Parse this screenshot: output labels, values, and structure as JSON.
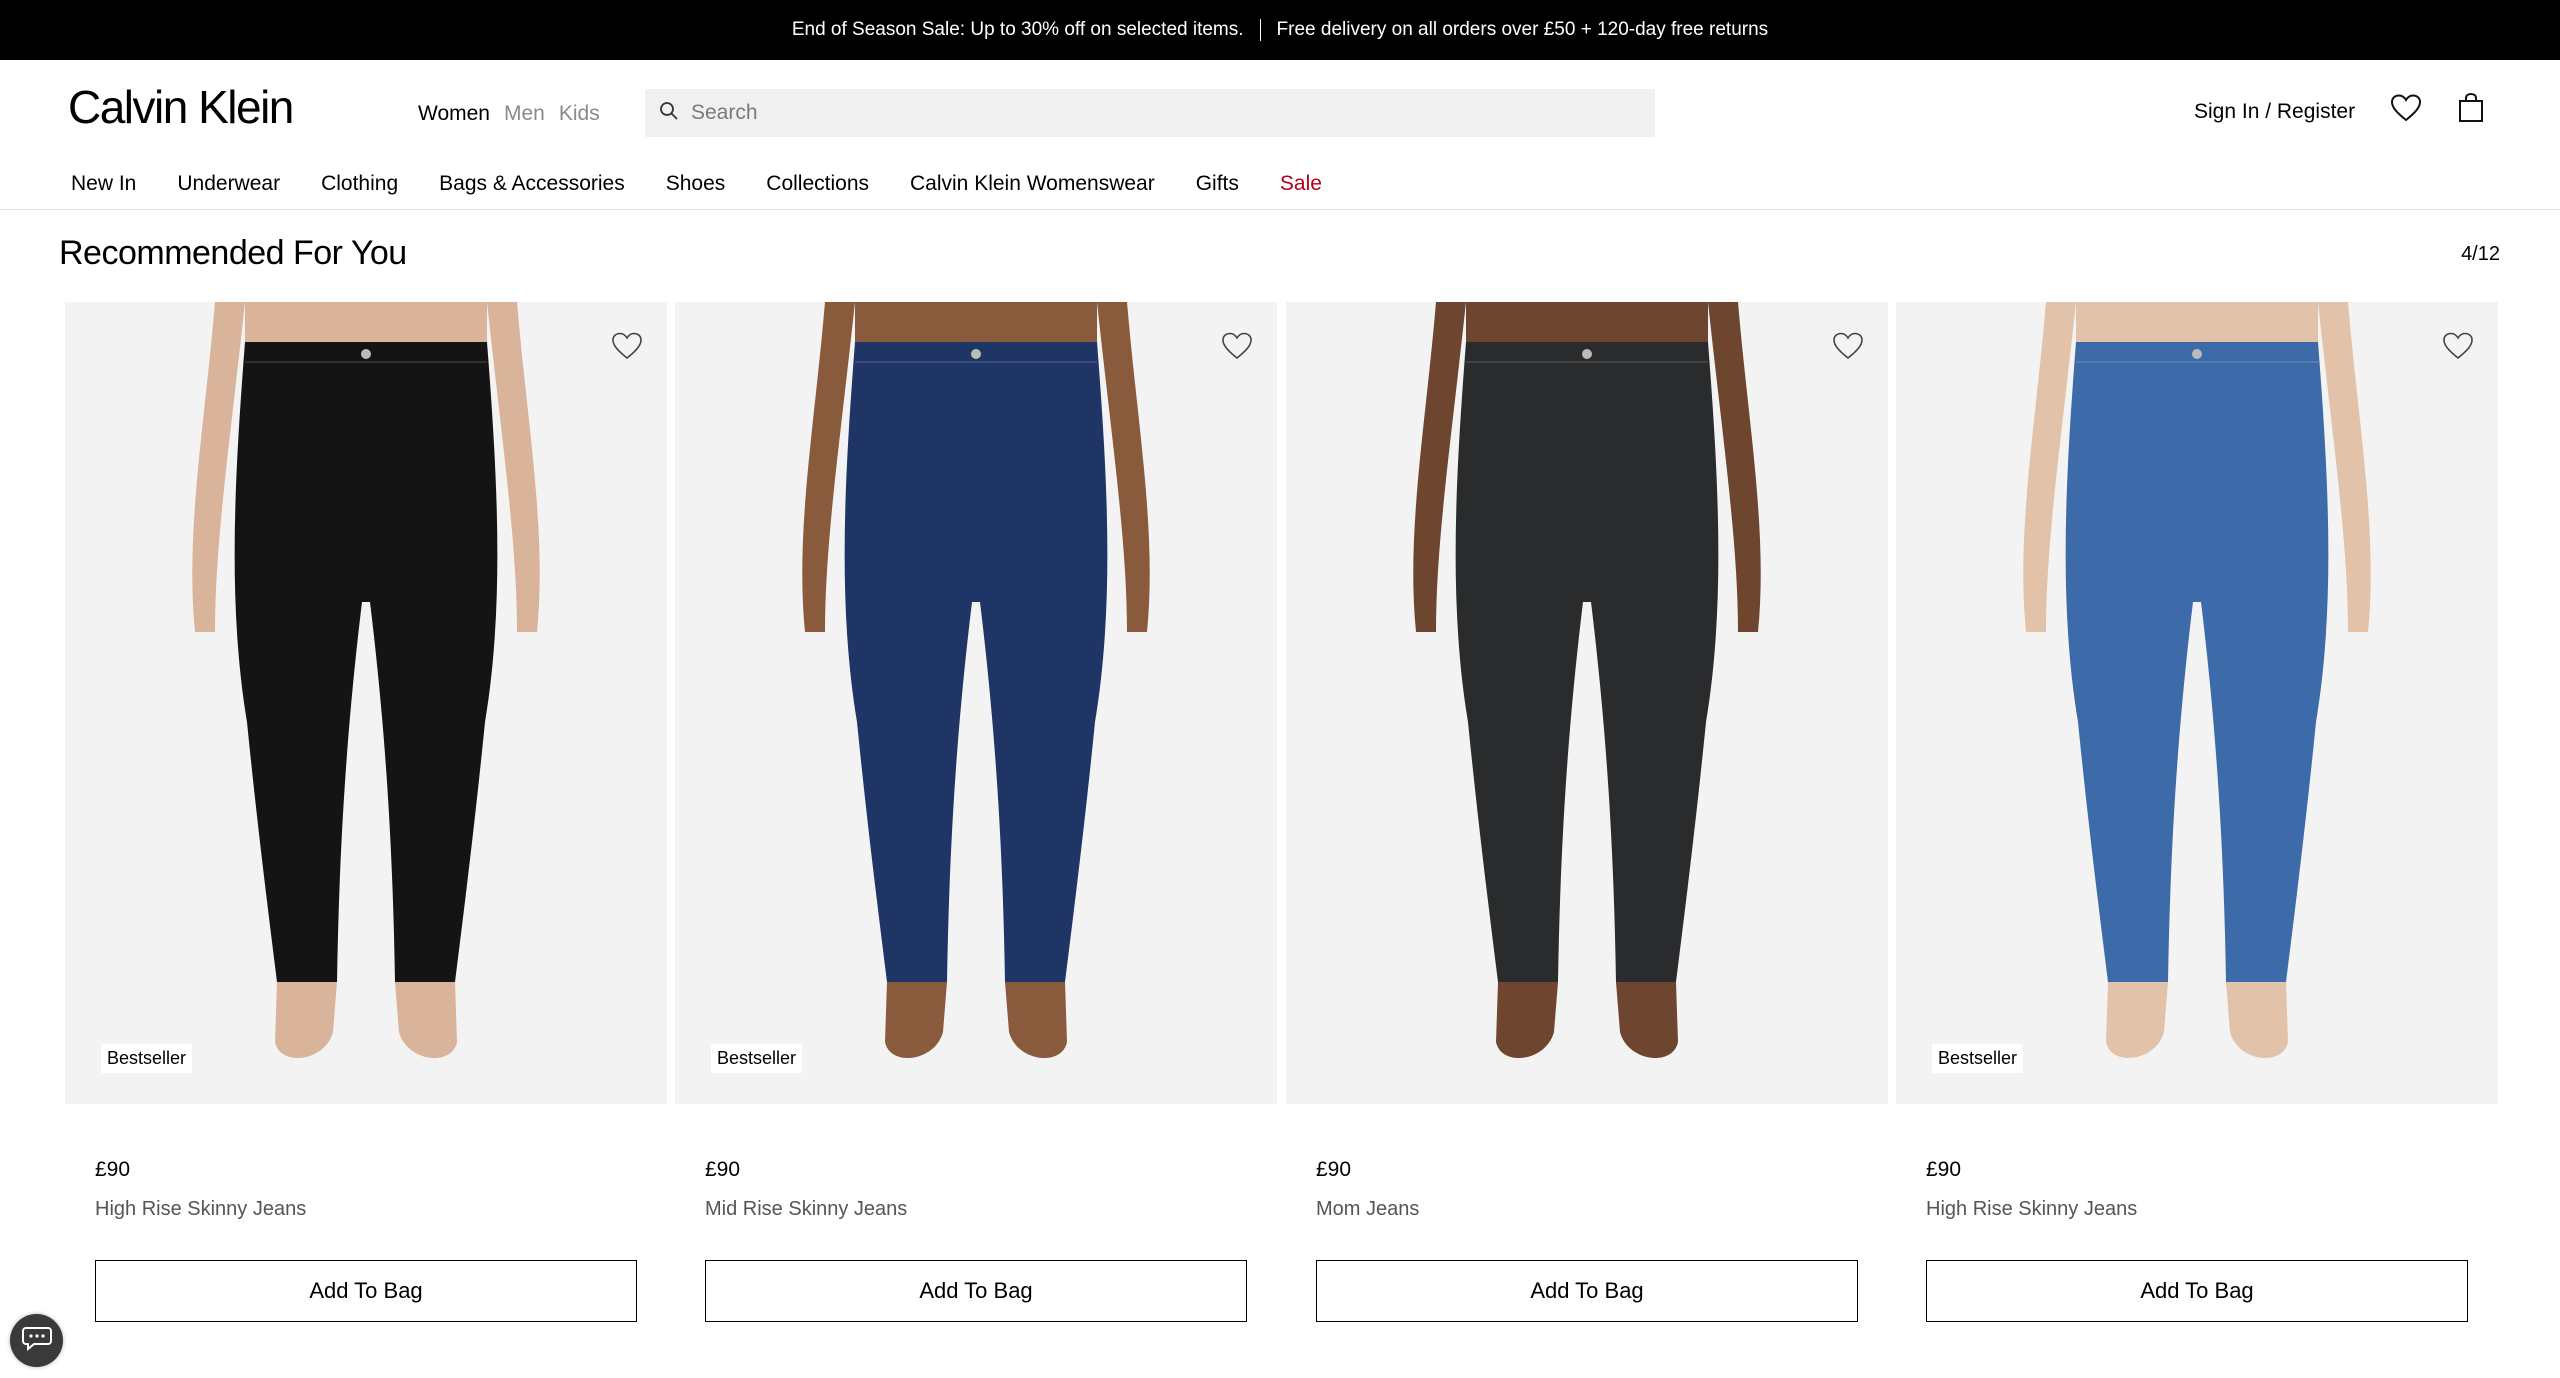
{
  "announcement": {
    "left": "End of Season Sale: Up to 30% off on selected items.",
    "right": "Free delivery on all orders over £50 + 120-day free returns"
  },
  "header": {
    "logo": "Calvin Klein",
    "gender_tabs": [
      "Women",
      "Men",
      "Kids"
    ],
    "search_placeholder": "Search",
    "sign_in": "Sign In / Register"
  },
  "nav": [
    "New In",
    "Underwear",
    "Clothing",
    "Bags & Accessories",
    "Shoes",
    "Collections",
    "Calvin Klein Womenswear",
    "Gifts",
    "Sale"
  ],
  "section": {
    "title": "Recommended For You",
    "pager": "4/12"
  },
  "products": [
    {
      "badge": "Bestseller",
      "price": "£90",
      "name": "High Rise Skinny Jeans",
      "button": "Add To Bag",
      "color": "#141414"
    },
    {
      "badge": "Bestseller",
      "price": "£90",
      "name": "Mid Rise Skinny Jeans",
      "button": "Add To Bag",
      "color": "#1f3566"
    },
    {
      "badge": "",
      "price": "£90",
      "name": "Mom Jeans",
      "button": "Add To Bag",
      "color": "#2a2b2d"
    },
    {
      "badge": "Bestseller",
      "price": "£90",
      "name": "High Rise Skinny Jeans",
      "button": "Add To Bag",
      "color": "#3d6aa8"
    }
  ],
  "colors": {
    "sale": "#b3001b",
    "announce_bg": "#000000"
  },
  "icons": [
    "search-icon",
    "heart-icon",
    "bag-icon",
    "chat-icon"
  ]
}
